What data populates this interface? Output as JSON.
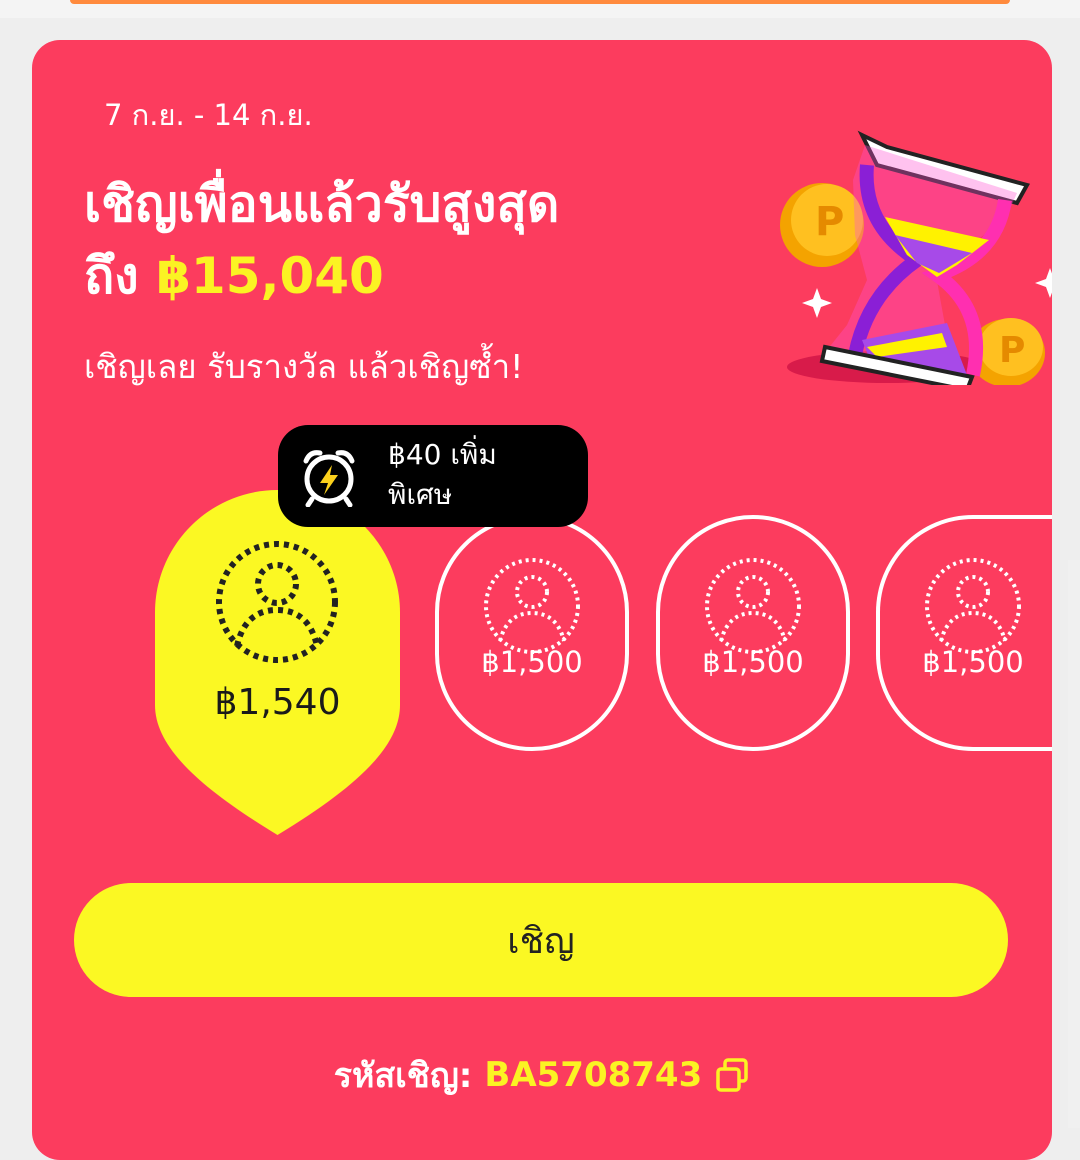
{
  "promo": {
    "date_range": "7 ก.ย. - 14 ก.ย.",
    "title_line1": "เชิญเพื่อนแล้วรับสูงสุด",
    "title_prefix": "ถึง",
    "title_amount": "฿15,040",
    "subtitle": "เชิญเลย รับรางวัล แล้วเชิญซ้ำ!"
  },
  "bonus_tag": {
    "line1": "฿40 เพิ่ม",
    "line2": "พิเศษ",
    "icon": "alarm-clock-icon"
  },
  "tiers": [
    {
      "value": "฿1,540",
      "active": true
    },
    {
      "value": "฿1,500",
      "active": false
    },
    {
      "value": "฿1,500",
      "active": false
    },
    {
      "value": "฿1,500",
      "active": false
    }
  ],
  "invite_button": {
    "label": "เชิญ"
  },
  "invite_code": {
    "label": "รหัสเชิญ:",
    "value": "BA5708743",
    "icon": "copy-icon"
  },
  "colors": {
    "card_bg": "#fc3c5e",
    "accent_yellow": "#fbf823",
    "bonus_bg": "#000000"
  }
}
